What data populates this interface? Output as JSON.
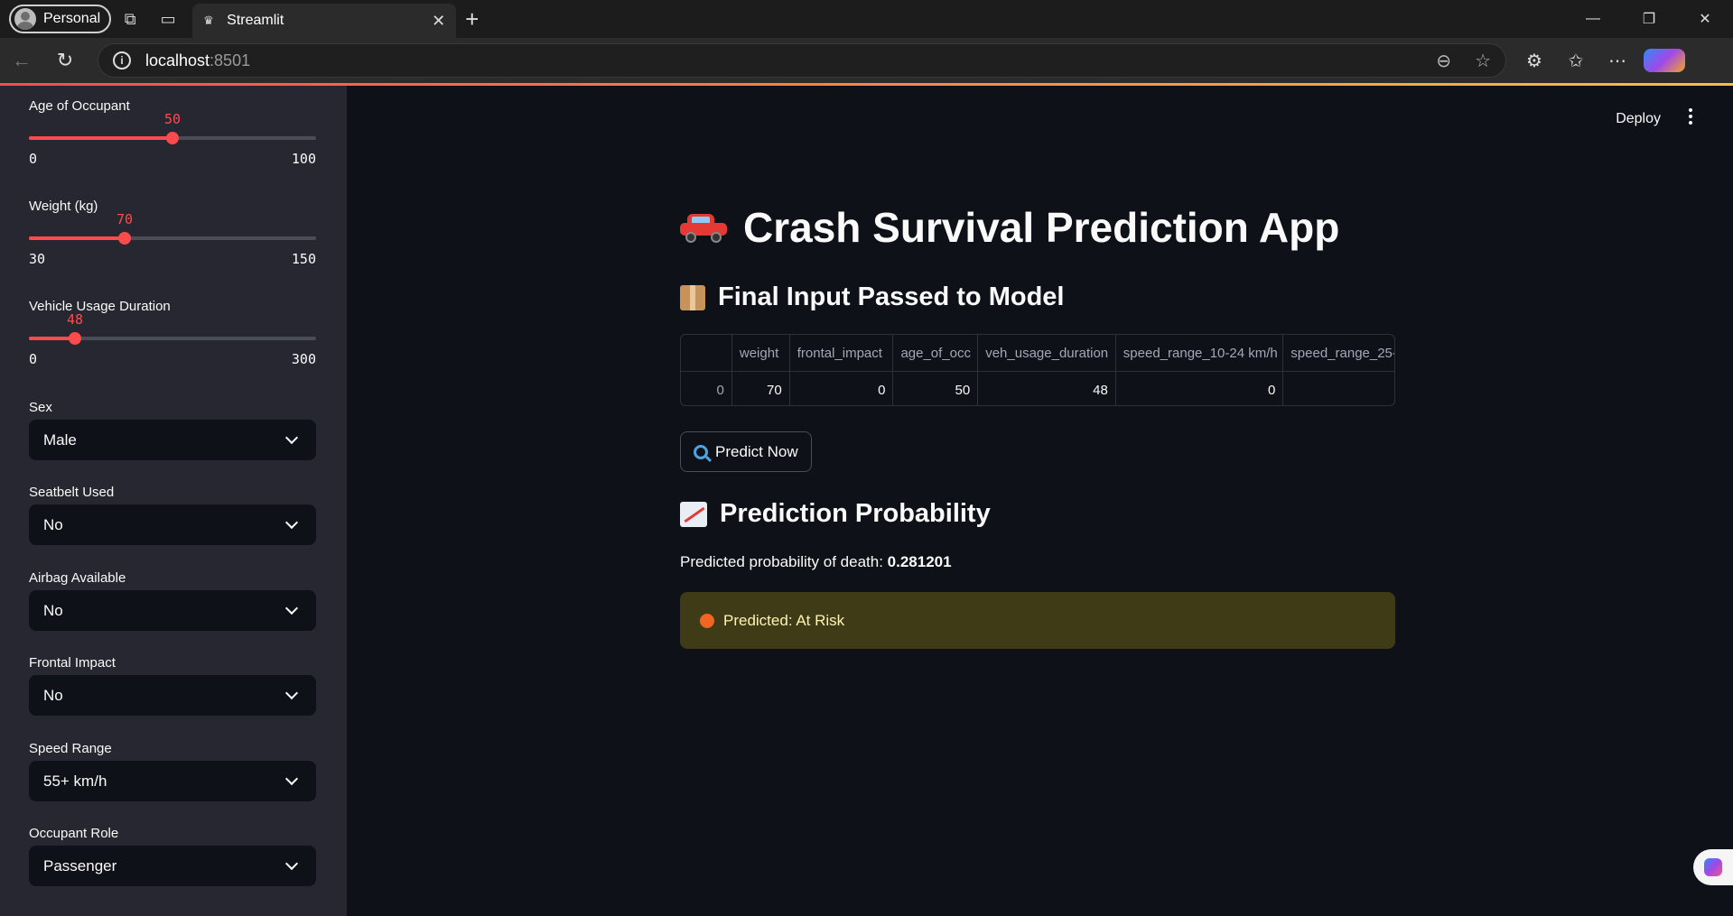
{
  "browser": {
    "profile_label": "Personal",
    "tab_title": "Streamlit",
    "url_host": "localhost",
    "url_port": ":8501"
  },
  "sidebar": {
    "sliders": [
      {
        "label": "Age of Occupant",
        "value": "50",
        "min": "0",
        "max": "100",
        "fraction": 0.5
      },
      {
        "label": "Weight (kg)",
        "value": "70",
        "min": "30",
        "max": "150",
        "fraction": 0.3333
      },
      {
        "label": "Vehicle Usage Duration",
        "value": "48",
        "min": "0",
        "max": "300",
        "fraction": 0.16
      }
    ],
    "selects": [
      {
        "label": "Sex",
        "value": "Male"
      },
      {
        "label": "Seatbelt Used",
        "value": "No"
      },
      {
        "label": "Airbag Available",
        "value": "No"
      },
      {
        "label": "Frontal Impact",
        "value": "No"
      },
      {
        "label": "Speed Range",
        "value": "55+ km/h"
      },
      {
        "label": "Occupant Role",
        "value": "Passenger"
      }
    ]
  },
  "main": {
    "deploy_label": "Deploy",
    "title": "Crash Survival Prediction App",
    "section_input": "Final Input Passed to Model",
    "table": {
      "columns": [
        "",
        "weight",
        "frontal_impact",
        "age_of_occ",
        "veh_usage_duration",
        "speed_range_10-24 km/h",
        "speed_range_25-"
      ],
      "rows": [
        [
          "0",
          "70",
          "0",
          "50",
          "48",
          "0",
          ""
        ]
      ]
    },
    "predict_button": "Predict Now",
    "section_prob": "Prediction Probability",
    "prob_label": "Predicted probability of death: ",
    "prob_value": "0.281201",
    "alert_text": "Predicted: At Risk"
  },
  "colors": {
    "accent": "#ff4b4b",
    "alert_bg": "#3e3b16",
    "alert_dot": "#f26522"
  }
}
